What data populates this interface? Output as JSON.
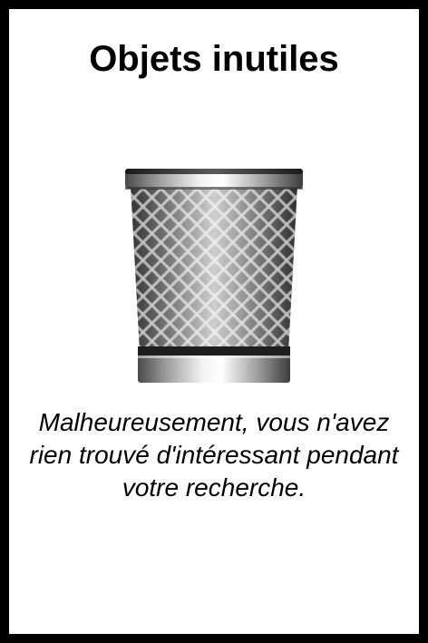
{
  "card": {
    "title": "Objets inutiles",
    "icon": "trash-bin-icon",
    "message": "Malheureusement, vous n'avez rien trouvé d'intéressant pendant votre recherche."
  },
  "colors": {
    "frame": "#000000",
    "background": "#ffffff",
    "text": "#000000"
  }
}
